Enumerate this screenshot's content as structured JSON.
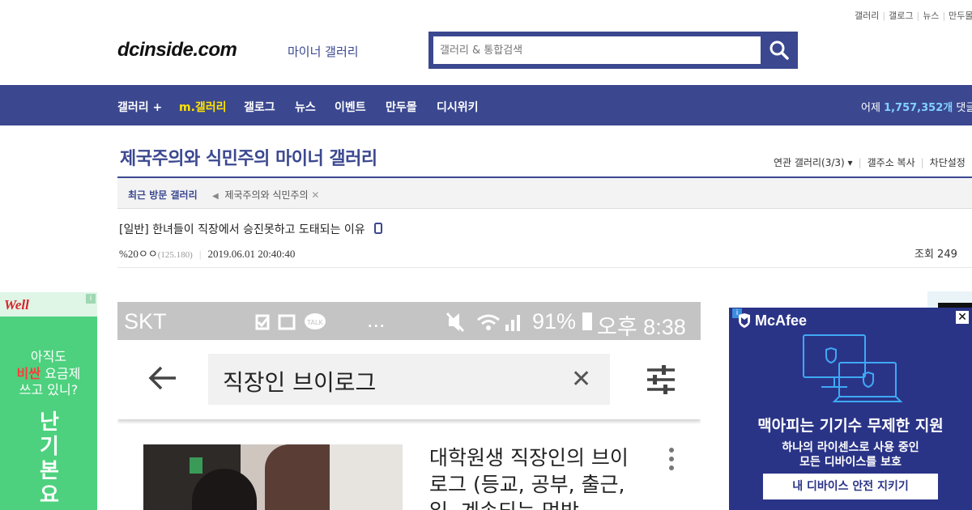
{
  "util_links": [
    "갤러리",
    "갤로그",
    "뉴스",
    "만두몰"
  ],
  "logo": {
    "text": "dcinside.com",
    "sub": "마이너 갤러리"
  },
  "search": {
    "placeholder": "갤러리 & 통합검색"
  },
  "nav": {
    "items": [
      "갤러리 +",
      "m.갤러리",
      "갤로그",
      "뉴스",
      "이벤트",
      "만두몰",
      "디시위키"
    ],
    "right_prefix": "어제",
    "right_count": "1,757,352개",
    "right_suffix": "댓글"
  },
  "gallery": {
    "title": "제국주의와 식민주의 마이너 갤러리",
    "tools": [
      "연관 갤러리(3/3)",
      "갤주소 복사",
      "차단설정"
    ]
  },
  "recent": {
    "label": "최근 방문 갤러리",
    "item": "제국주의와 식민주의"
  },
  "post": {
    "title": "[일반] 한녀들이 직장에서 승진못하고 도태되는 이유",
    "author": "%20ㅇㅇ",
    "ip": "(125.180)",
    "date": "2019.06.01 20:40:40",
    "views_label": "조회 249"
  },
  "ad_left": {
    "brand": "Well",
    "line1": "아직도",
    "line2_highlight": "비싼",
    "line2_rest": " 요금제",
    "line3": "쓰고 있니?",
    "vertical": "난 기본요"
  },
  "phone": {
    "carrier": "SKT",
    "status_more": "...",
    "battery": "91%",
    "time": "오후 8:38",
    "query": "직장인 브이로그",
    "video_title": "대학원생 직장인의 브이로그 (등교, 공부, 출근, 일, 계속되는 먹방"
  },
  "ad_right": {
    "brand": "McAfee",
    "headline": "맥아피는 기기수 무제한 지원",
    "sub1": "하나의 라이센스로 사용 중인",
    "sub2": "모든 디바이스를 보호",
    "cta": "내 디바이스 안전 지키기"
  },
  "colors": {
    "brand": "#3b4890",
    "highlight": "#ffe400",
    "count": "#82d2ff",
    "ad_green": "#4dd17e",
    "ad_blue": "#2a3487"
  }
}
